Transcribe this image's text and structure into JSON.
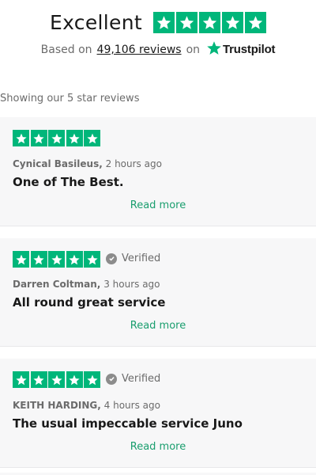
{
  "summary": {
    "rating_word": "Excellent",
    "stars": 5,
    "based_on": "Based on",
    "review_count": "49,106 reviews",
    "on_word": "on",
    "brand": "Trustpilot"
  },
  "filter_text": "Showing our 5 star reviews",
  "colors": {
    "star_green": "#00b67a",
    "card_bg": "#f7f7f8",
    "link_green": "#1a9e6e"
  },
  "reviews": [
    {
      "stars": 5,
      "verified": "",
      "author": "Cynical Basileus,",
      "time": "2 hours ago",
      "title": "One of The Best.",
      "read_more": "Read more"
    },
    {
      "stars": 5,
      "verified": "Verified",
      "author": "Darren Coltman,",
      "time": "3 hours ago",
      "title": "All round great service",
      "read_more": "Read more"
    },
    {
      "stars": 5,
      "verified": "Verified",
      "author": "KEITH HARDING,",
      "time": "4 hours ago",
      "title": "The usual impeccable service Juno",
      "read_more": "Read more"
    }
  ]
}
